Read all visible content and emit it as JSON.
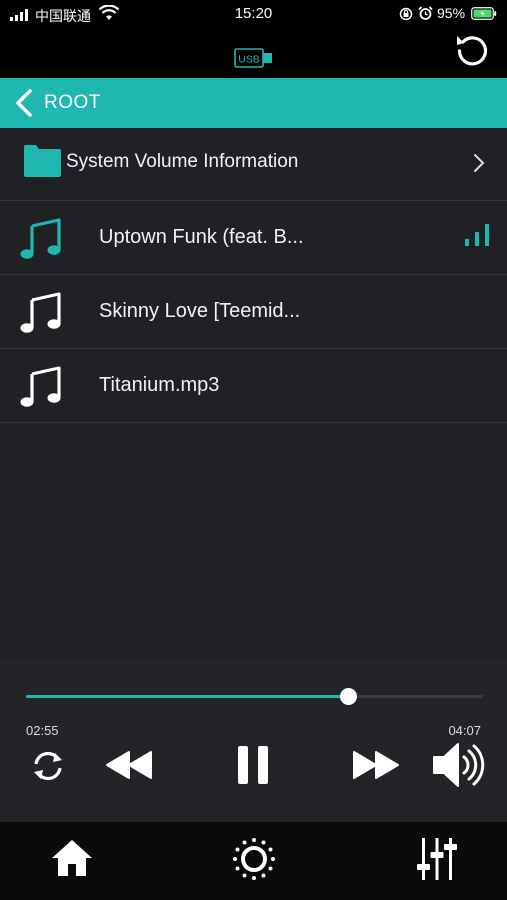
{
  "status_bar": {
    "carrier": "中国联通",
    "time": "15:20",
    "battery": "95%"
  },
  "header": {
    "source_badge": "USB",
    "refresh_icon": "refresh-icon"
  },
  "breadcrumb": {
    "label": "ROOT"
  },
  "list": {
    "folder": {
      "name": "System Volume Information"
    },
    "songs": [
      {
        "name": "Uptown Funk (feat. B...",
        "playing": true
      },
      {
        "name": "Skinny Love [Teemid...",
        "playing": false
      },
      {
        "name": "Titanium.mp3",
        "playing": false
      }
    ]
  },
  "player": {
    "current_time": "02:55",
    "total_time": "04:07",
    "progress": 0.705
  },
  "colors": {
    "accent": "#1fb8b0",
    "list_bg": "#202124",
    "player_bg": "#232427"
  },
  "tabs": [
    "home-icon",
    "light-icon",
    "equalizer-icon"
  ]
}
